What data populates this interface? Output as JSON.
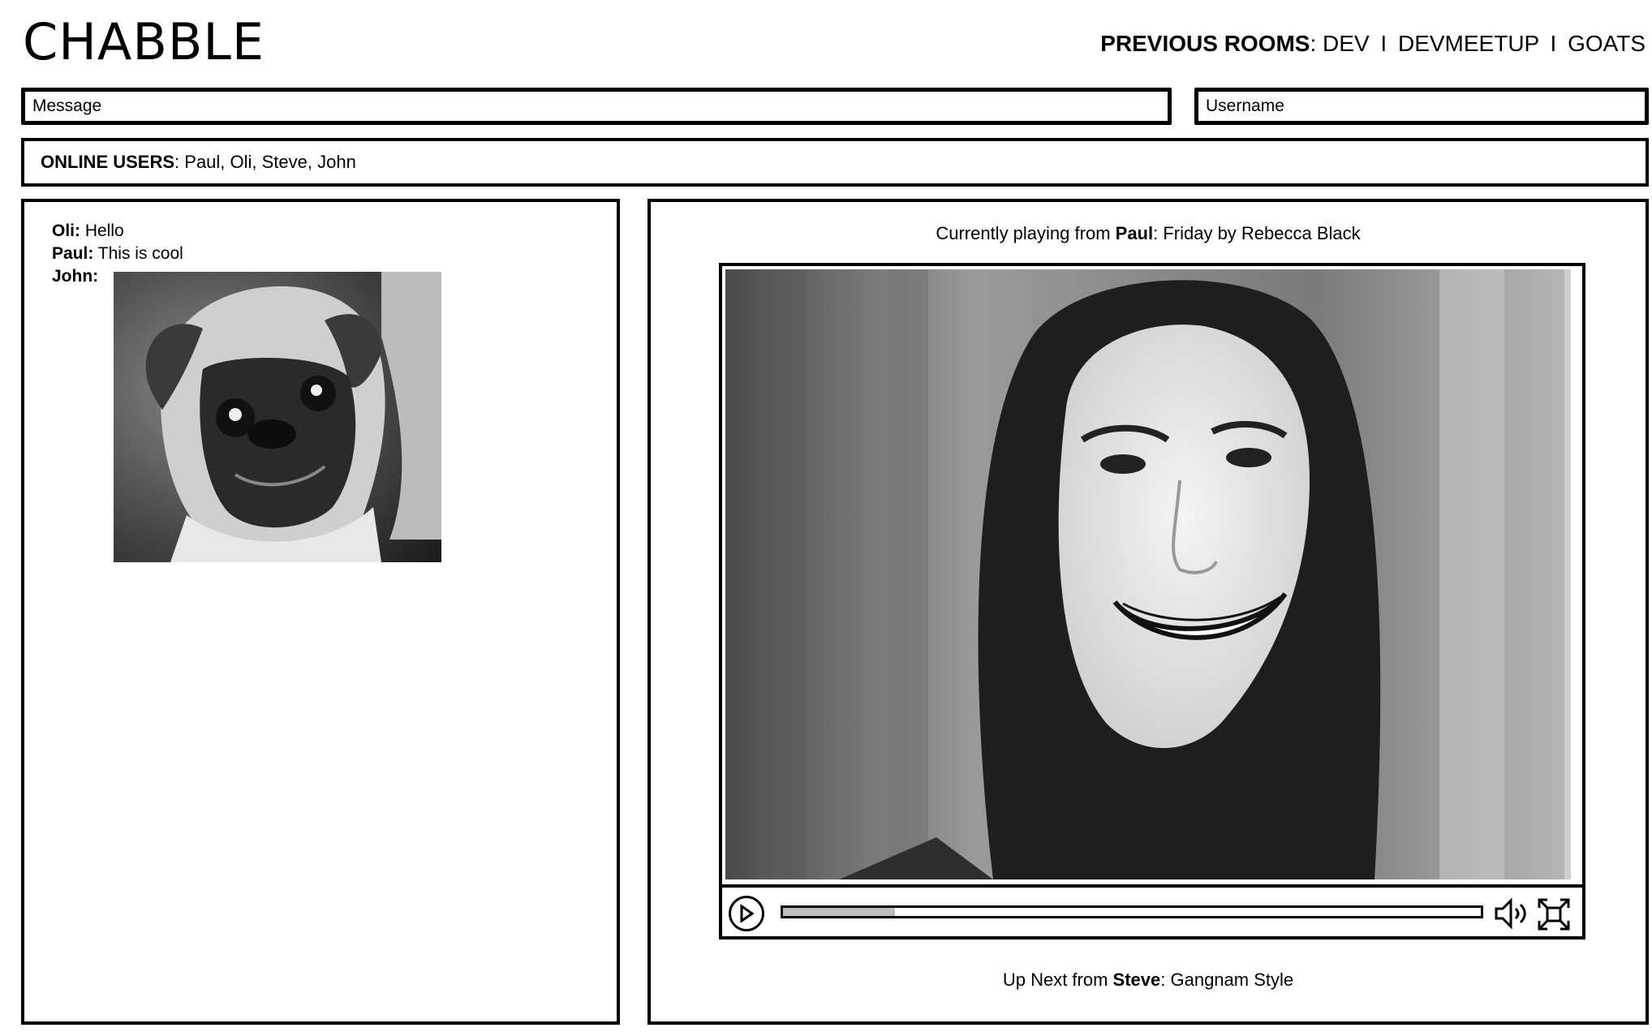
{
  "app": {
    "title": "CHABBLE"
  },
  "previous_rooms": {
    "label": "PREVIOUS ROOMS",
    "separator": "I",
    "rooms": [
      "DEV",
      "DEVMEETUP",
      "GOATS"
    ]
  },
  "inputs": {
    "message_placeholder": "Message",
    "username_placeholder": "Username"
  },
  "online_users": {
    "label": "ONLINE USERS",
    "users": "Paul, Oli, Steve, John"
  },
  "chat": {
    "messages": [
      {
        "user": "Oli:",
        "text": " Hello"
      },
      {
        "user": "Paul:",
        "text": " This is cool"
      },
      {
        "user": "John:",
        "text": ""
      }
    ],
    "image_icon": "pug-photo"
  },
  "player": {
    "now_playing_prefix": "Currently playing from ",
    "now_playing_user": "Paul",
    "now_playing_title": ": Friday by Rebecca Black",
    "up_next_prefix": "Up Next from ",
    "up_next_user": "Steve",
    "up_next_title": ": Gangnam Style",
    "progress": 0.16,
    "icons": {
      "play": "play-icon",
      "volume": "volume-icon",
      "fullscreen": "fullscreen-icon"
    }
  }
}
